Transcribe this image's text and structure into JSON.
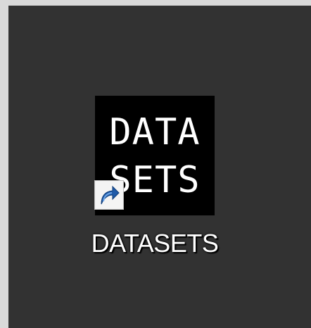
{
  "desktop": {
    "shortcut": {
      "icon_line_1": "DATA",
      "icon_line_2": "SETS",
      "overlay_icon": "shortcut-arrow-icon",
      "label": "DATASETS"
    }
  },
  "colors": {
    "desktop_background": "#323232",
    "frame_background": "#d9d9d9",
    "icon_background": "#000000",
    "icon_text": "#ffffff",
    "shortcut_arrow": "#1f5aa8"
  }
}
